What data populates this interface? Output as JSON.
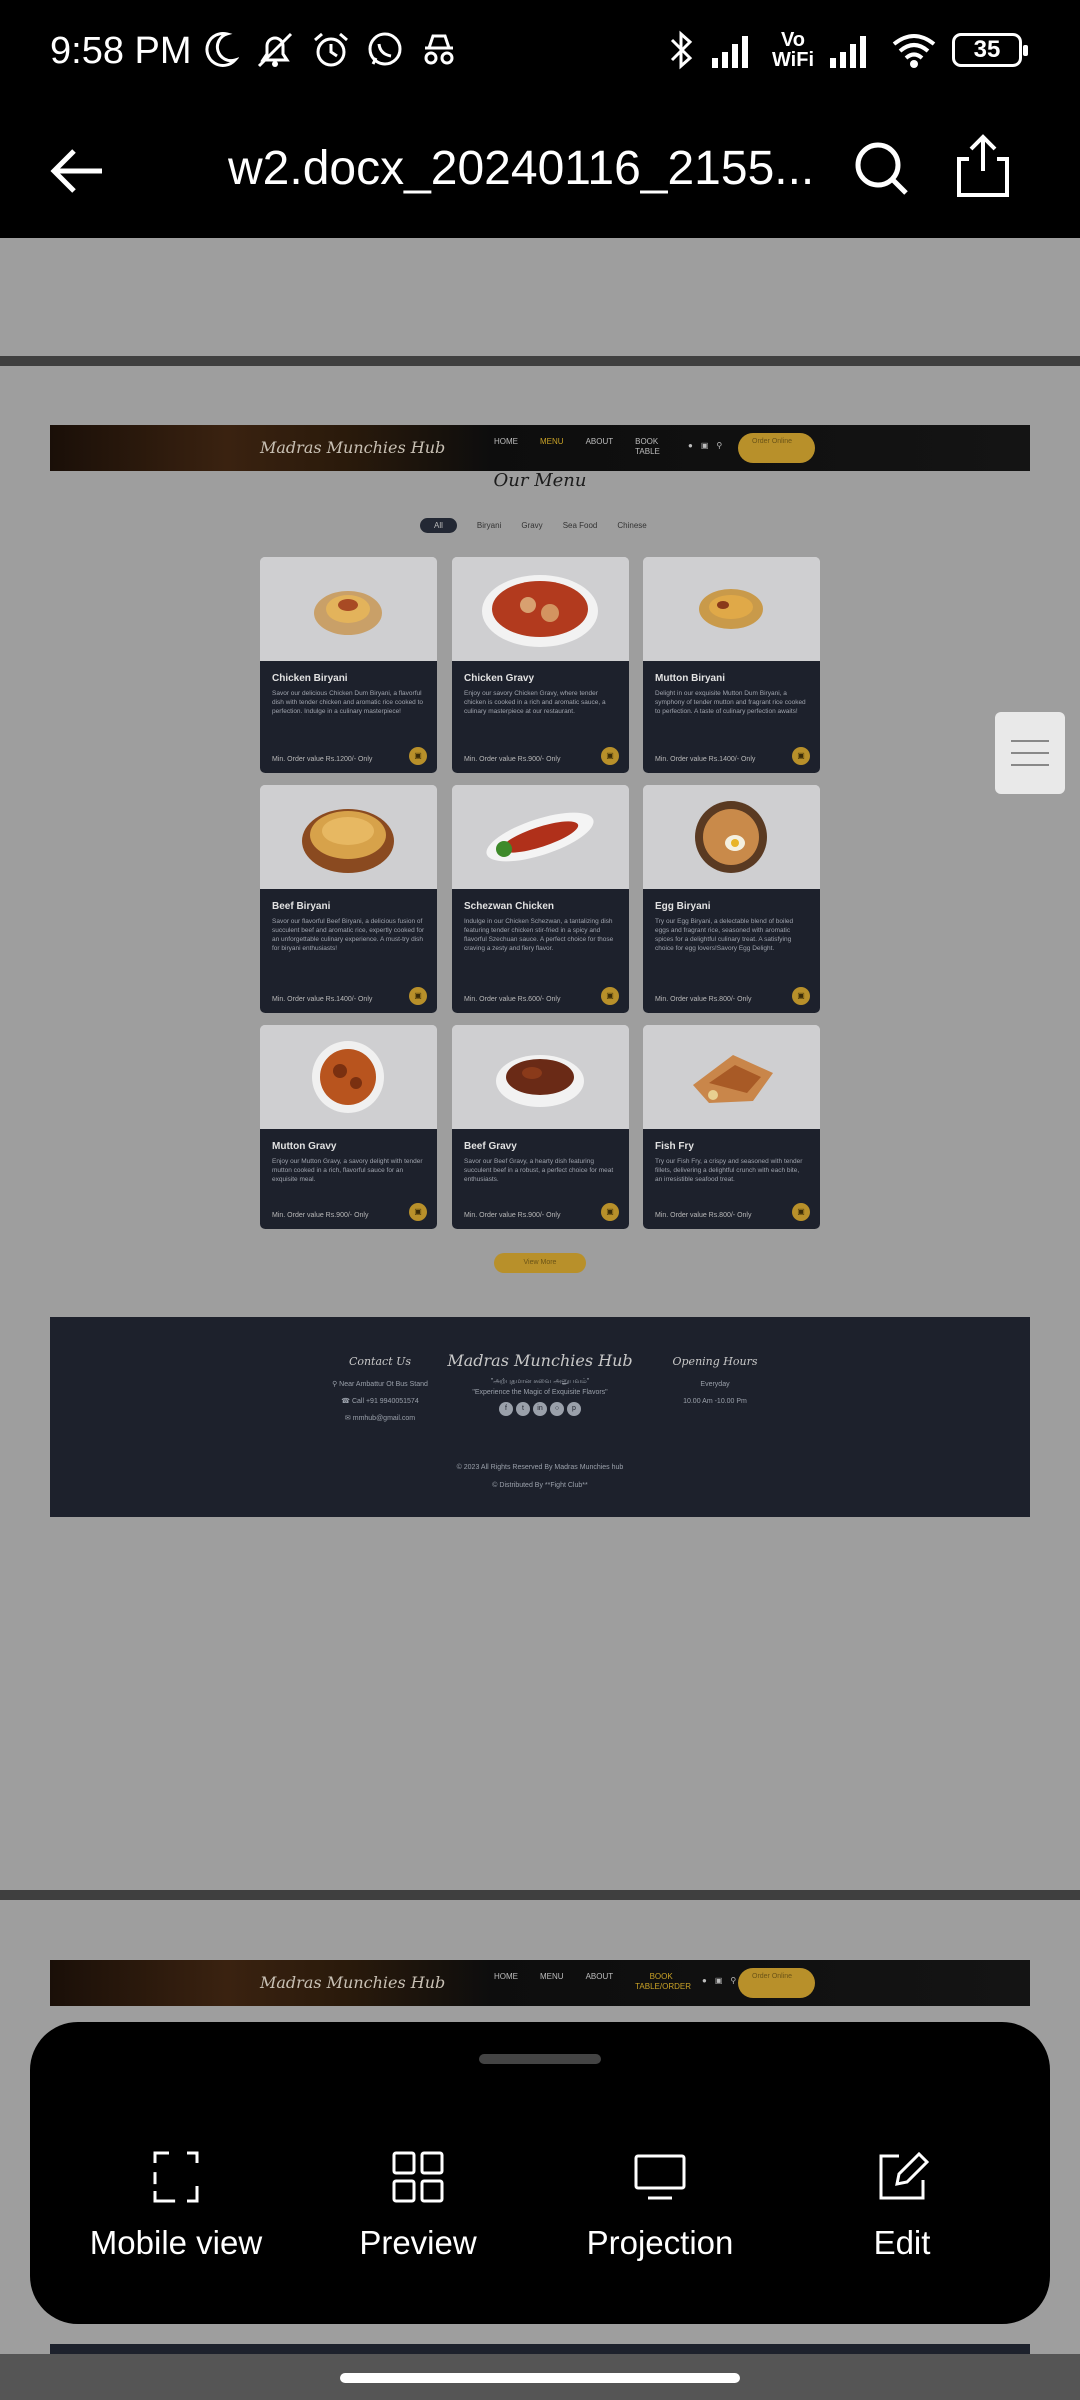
{
  "status_bar": {
    "time": "9:58 PM",
    "volte_top": "Vo",
    "volte_bottom": "WiFi",
    "battery": "35"
  },
  "app_bar": {
    "title": "w2.docx_20240116_2155..."
  },
  "site": {
    "logo": "Madras Munchies Hub",
    "nav": [
      "HOME",
      "MENU",
      "ABOUT",
      "BOOK TABLE"
    ],
    "nav2": [
      "HOME",
      "MENU",
      "ABOUT",
      "BOOK TABLE/ORDER"
    ],
    "order_button": "Order Online",
    "menu_title": "Our Menu",
    "filters": [
      "All",
      "Biryani",
      "Gravy",
      "Sea Food",
      "Chinese"
    ],
    "view_more": "View More",
    "dishes": [
      {
        "name": "Chicken Biryani",
        "desc": "Savor our delicious Chicken Dum Biryani, a flavorful dish with tender chicken and aromatic rice cooked to perfection. Indulge in a culinary masterpiece!",
        "price": "Min. Order value Rs.1200/- Only"
      },
      {
        "name": "Chicken Gravy",
        "desc": "Enjoy our savory Chicken Gravy, where tender chicken is cooked in a rich and aromatic sauce, a culinary masterpiece at our restaurant.",
        "price": "Min. Order value Rs.900/- Only"
      },
      {
        "name": "Mutton Biryani",
        "desc": "Delight in our exquisite Mutton Dum Biryani, a symphony of tender mutton and fragrant rice cooked to perfection. A taste of culinary perfection awaits!",
        "price": "Min. Order value Rs.1400/- Only"
      },
      {
        "name": "Beef Biryani",
        "desc": "Savor our flavorful Beef Biryani, a delicious fusion of succulent beef and aromatic rice, expertly cooked for an unforgettable culinary experience. A must-try dish for biryani enthusiasts!",
        "price": "Min. Order value Rs.1400/- Only"
      },
      {
        "name": "Schezwan Chicken",
        "desc": "Indulge in our Chicken Schezwan, a tantalizing dish featuring tender chicken stir-fried in a spicy and flavorful Szechuan sauce. A perfect choice for those craving a zesty and fiery flavor.",
        "price": "Min. Order value Rs.600/- Only"
      },
      {
        "name": "Egg Biryani",
        "desc": "Try our Egg Biryani, a delectable blend of boiled eggs and fragrant rice, seasoned with aromatic spices for a delightful culinary treat. A satisfying choice for egg lovers!Savory Egg Delight.",
        "price": "Min. Order value Rs.800/- Only"
      },
      {
        "name": "Mutton Gravy",
        "desc": "Enjoy our Mutton Gravy, a savory delight with tender mutton cooked in a rich, flavorful sauce for an exquisite meal.",
        "price": "Min. Order value Rs.900/- Only"
      },
      {
        "name": "Beef Gravy",
        "desc": "Savor our Beef Gravy, a hearty dish featuring succulent beef in a robust, a perfect choice for meat enthusiasts.",
        "price": "Min. Order value Rs.900/- Only"
      },
      {
        "name": "Fish Fry",
        "desc": "Try our Fish Fry, a crispy and seasoned with tender fillets, delivering a delightful crunch with each bite, an irresistible seafood treat.",
        "price": "Min. Order value Rs.800/- Only"
      }
    ],
    "footer": {
      "contact_title": "Contact Us",
      "address": "Near Ambattur Ot Bus Stand",
      "phone": "Call +91 9940051574",
      "email": "mmhub@gmail.com",
      "brand": "Madras Munchies Hub",
      "tagline_tamil": "\"அற்புதமான சுவை அனுபவம்\"",
      "tagline": "\"Experience the Magic of Exquisite Flavors\"",
      "hours_title": "Opening Hours",
      "hours_days": "Everyday",
      "hours_time": "10.00 Am -10.00 Pm",
      "copyright": "© 2023 All Rights Reserved By Madras Munchies hub",
      "distributed": "© Distributed By **Fight Club**"
    }
  },
  "bottom_sheet": {
    "actions": [
      {
        "label": "Mobile view",
        "icon": "mobile-view-icon"
      },
      {
        "label": "Preview",
        "icon": "grid-icon"
      },
      {
        "label": "Projection",
        "icon": "monitor-icon"
      },
      {
        "label": "Edit",
        "icon": "edit-icon"
      }
    ]
  },
  "colors": {
    "accent_gold": "#b8902a",
    "card_dark": "#1d212c",
    "doc_background": "#9e9e9e"
  }
}
